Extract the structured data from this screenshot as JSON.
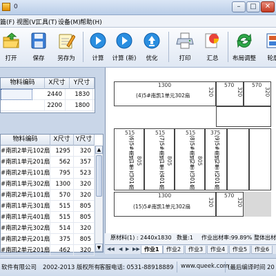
{
  "window": {
    "title": "0",
    "buttons": {
      "minimize": "–",
      "maximize": "□",
      "close": "✕"
    }
  },
  "menu": [
    "篇(F)",
    "视图(V)",
    "工具(T)",
    "设备(M)",
    "帮助(H)"
  ],
  "toolbar": [
    {
      "label": "打开",
      "icon": "open-folder-icon"
    },
    {
      "label": "保存",
      "icon": "save-disk-icon"
    },
    {
      "label": "另存为",
      "icon": "save-as-icon"
    },
    {
      "label": "计算",
      "icon": "play-icon"
    },
    {
      "label": "计算 (新)",
      "icon": "play-icon"
    },
    {
      "label": "优化",
      "icon": "optimize-icon"
    },
    {
      "label": "打印",
      "icon": "printer-icon"
    },
    {
      "label": "汇总",
      "icon": "summary-icon"
    },
    {
      "label": "布局调整",
      "icon": "refresh-icon"
    },
    {
      "label": "轮廓",
      "icon": "outline-icon"
    }
  ],
  "stock_table": {
    "columns": [
      "物料编码",
      "X尺寸",
      "Y尺寸"
    ],
    "rows": [
      {
        "code": "",
        "x": "2440",
        "y": "1830"
      },
      {
        "code": "",
        "x": "2200",
        "y": "1800"
      }
    ]
  },
  "parts_table": {
    "columns": [
      "物料编码",
      "X尺寸",
      "Y尺寸"
    ],
    "rows": [
      {
        "code": "#南凯2单元102扇",
        "x": "1295",
        "y": "320"
      },
      {
        "code": "#南凯1单元201扇",
        "x": "562",
        "y": "357"
      },
      {
        "code": "#南凯2单元101扇",
        "x": "795",
        "y": "523"
      },
      {
        "code": "#南凯1单元302扇",
        "x": "1300",
        "y": "320"
      },
      {
        "code": "#南凯2单元101扇",
        "x": "570",
        "y": "320"
      },
      {
        "code": "#南凯1单元301扇",
        "x": "515",
        "y": "805"
      },
      {
        "code": "#南凯1单元401扇",
        "x": "515",
        "y": "805"
      },
      {
        "code": "#南凯2单元302扇",
        "x": "514",
        "y": "320"
      },
      {
        "code": "#南凯2单元201扇",
        "x": "375",
        "y": "805"
      },
      {
        "code": "#南凯2单元201扇",
        "x": "462",
        "y": "320"
      }
    ]
  },
  "layout": {
    "top_left_piece": {
      "dim_top": "1300",
      "label": "(4)5#南凯1单元302扇",
      "dim_side": "320"
    },
    "top_right_pieces": [
      {
        "dim_top": "570",
        "dim_side": "320"
      },
      {
        "dim_top": "570",
        "dim_side": "320"
      }
    ],
    "mid_pieces": [
      {
        "dim_top": "515",
        "label": "(6)5#南凯1单元301扇",
        "dim_side": "805"
      },
      {
        "dim_top": "515",
        "label": "(7)5#南凯1单元401扇",
        "dim_side": "805"
      },
      {
        "dim_top": "515",
        "label": "(8)5#南凯2单元301扇",
        "dim_side": "805"
      },
      {
        "dim_top": "375",
        "label": "(9)5#南凯2单元201扇",
        "dim_side": ""
      }
    ],
    "bottom_left_piece": {
      "dim_top": "1300",
      "label": "(15)5#南凯1单元302扇",
      "dim_side": "320"
    },
    "bottom_right_pieces": [
      {
        "dim_top": "570",
        "dim_side": "320"
      }
    ]
  },
  "info": {
    "material": "原材料(1) : 2440x1830",
    "count": "数量:1",
    "yield": "作业出材率:99.89%",
    "total_yield": "整体出材率"
  },
  "sheet_tabs": [
    "作业1",
    "作业2",
    "作业3",
    "作业4",
    "作业5",
    "作业6"
  ],
  "status": {
    "company": "软件有限公司",
    "copyright": "2002-2013 版权所有",
    "phone": "客服电话: 0531-88918889",
    "website": "www.queek.com",
    "date": "(最后编译时间 20"
  },
  "colors": {
    "title_bar": "#c5d6ee",
    "toolbar_bg": "#e8eef7",
    "canvas_bg": "#ffffff",
    "piece_border": "#444444",
    "status_bg": "#d9e3f0"
  }
}
